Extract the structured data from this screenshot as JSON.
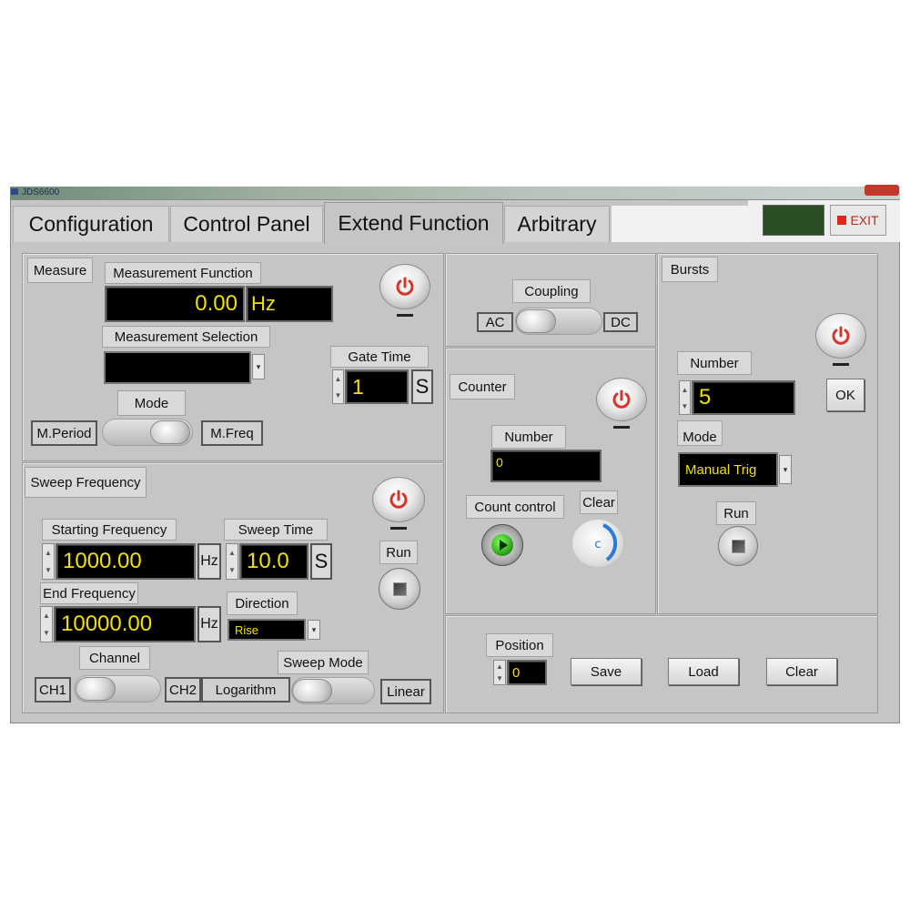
{
  "window": {
    "title": "JDS6600"
  },
  "tabs": [
    {
      "label": "Configuration"
    },
    {
      "label": "Control Panel"
    },
    {
      "label": "Extend Function"
    },
    {
      "label": "Arbitrary"
    }
  ],
  "header": {
    "exit_label": "EXIT",
    "status_color": "#2a4f25"
  },
  "measure": {
    "button": "Measure",
    "function_label": "Measurement Function",
    "value": "0.00",
    "unit": "Hz",
    "selection_label": "Measurement Selection",
    "selection_value": "",
    "gate_time_label": "Gate Time",
    "gate_time_value": "1",
    "gate_time_unit": "S",
    "mode_label": "Mode",
    "mode_left": "M.Period",
    "mode_right": "M.Freq"
  },
  "coupling": {
    "label": "Coupling",
    "left": "AC",
    "right": "DC"
  },
  "counter": {
    "button": "Counter",
    "number_label": "Number",
    "number_value": "0",
    "count_control_label": "Count control",
    "clear_label": "Clear"
  },
  "bursts": {
    "button": "Bursts",
    "number_label": "Number",
    "number_value": "5",
    "ok_label": "OK",
    "mode_label": "Mode",
    "mode_value": "Manual Trig",
    "run_label": "Run"
  },
  "sweep": {
    "button": "Sweep Frequency",
    "start_label": "Starting Frequency",
    "start_value": "1000.00",
    "start_unit": "Hz",
    "time_label": "Sweep Time",
    "time_value": "10.0",
    "time_unit": "S",
    "run_label": "Run",
    "end_label": "End Frequency",
    "end_value": "10000.00",
    "end_unit": "Hz",
    "direction_label": "Direction",
    "direction_value": "Rise",
    "channel_label": "Channel",
    "channel_left": "CH1",
    "channel_right": "CH2",
    "sweep_mode_label": "Sweep Mode",
    "sweep_mode_left": "Logarithm",
    "sweep_mode_right": "Linear"
  },
  "position": {
    "label": "Position",
    "value": "0",
    "save_label": "Save",
    "load_label": "Load",
    "clear_label": "Clear"
  }
}
